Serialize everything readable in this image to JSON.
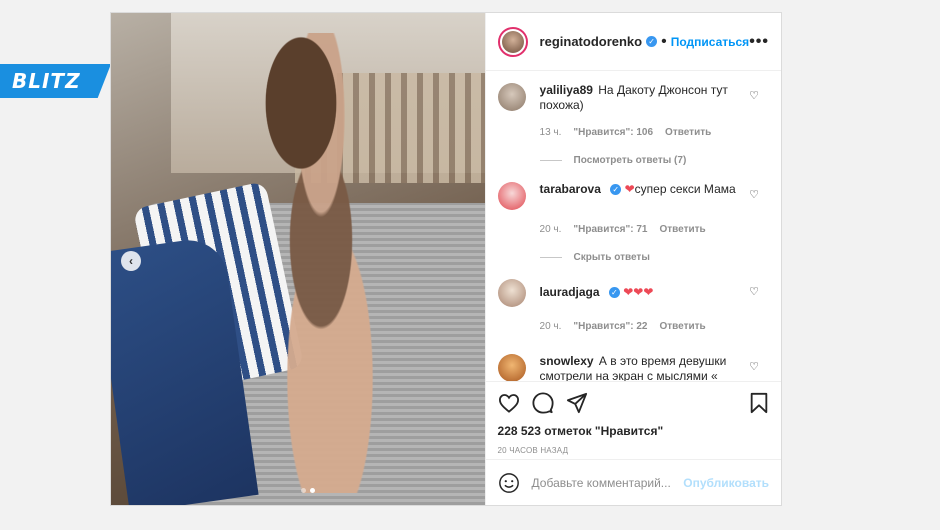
{
  "brand": {
    "logo_text": "BLITZ",
    "accent": "#1a8fe0"
  },
  "post": {
    "author": "reginatodorenko",
    "separator": "•",
    "follow_label": "Подписаться",
    "menu_label": "•••",
    "likes_text": "228 523 отметок \"Нравится\"",
    "time_text": "20 ЧАСОВ НАЗАД",
    "carousel": {
      "slide_count": 2,
      "active_slide": 2
    }
  },
  "comments": [
    {
      "user": "yaliliya89",
      "verified": false,
      "text": "На Дакоту Джонсон тут похожа)",
      "time": "13 ч.",
      "likes": "\"Нравится\": 106",
      "reply": "Ответить",
      "replies_toggle": "Посмотреть ответы (7)",
      "avatar_color": "#b9a89a"
    },
    {
      "user": "tarabarova",
      "verified": true,
      "hearts": "❤",
      "text": "супер секси Мама",
      "time": "20 ч.",
      "likes": "\"Нравится\": 71",
      "reply": "Ответить",
      "replies_toggle": "Скрыть ответы",
      "avatar_color": "#e0464e"
    },
    {
      "user": "lauradjaga",
      "verified": true,
      "hearts": "❤❤❤",
      "text": "",
      "time": "20 ч.",
      "likes": "\"Нравится\": 22",
      "reply": "Ответить",
      "avatar_color": "#c7a891"
    },
    {
      "user": "snowlexy",
      "verified": false,
      "text": "А в это время девушки смотрели на экран с мыслями « Регина красотка!»",
      "avatar_color": "#d98a3a"
    }
  ],
  "composer": {
    "placeholder": "Добавьте комментарий...",
    "publish_label": "Опубликовать"
  },
  "icons": [
    "heart-icon",
    "comment-icon",
    "share-icon",
    "bookmark-icon",
    "emoji-icon",
    "verified-icon",
    "chevron-left-icon"
  ]
}
